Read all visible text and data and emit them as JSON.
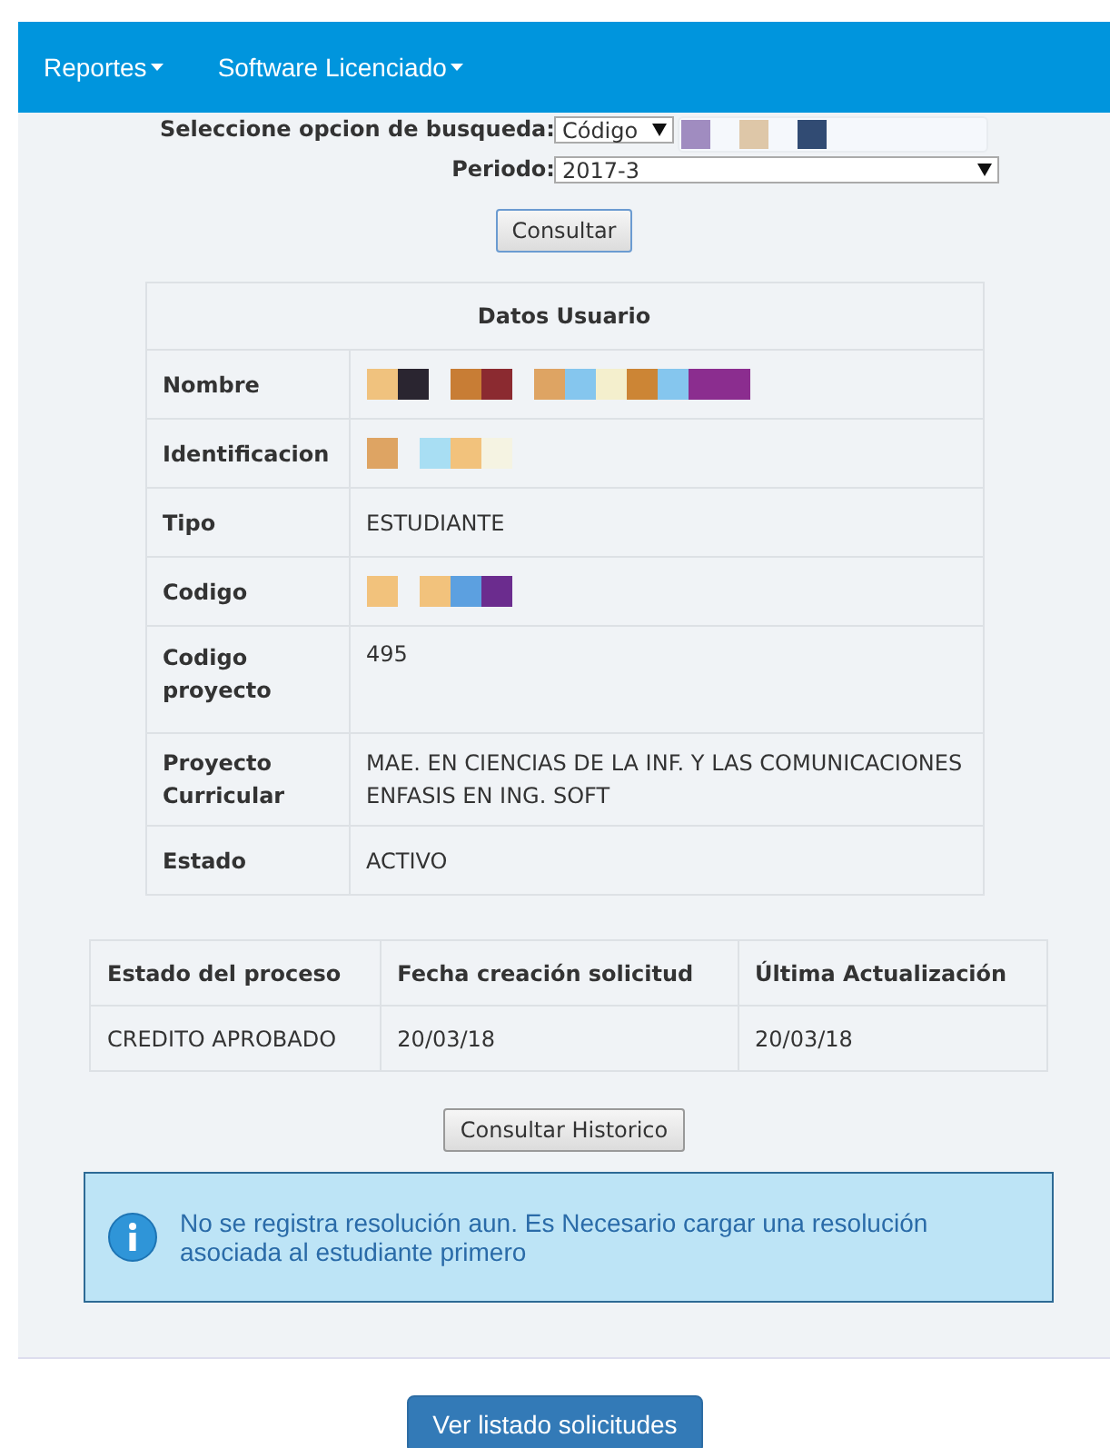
{
  "navbar": {
    "menus": [
      {
        "label": "Reportes"
      },
      {
        "label": "Software Licenciado"
      }
    ]
  },
  "search": {
    "label": "Seleccione opcion de busqueda",
    "colon": ":",
    "option": "Código",
    "value_redacted": [
      [
        {
          "color": "#a08cc0"
        }
      ],
      [
        {
          "color": "#dec7a8"
        }
      ],
      [
        {
          "color": "#314b73"
        }
      ]
    ]
  },
  "period": {
    "label": "Periodo",
    "colon": ":",
    "value": "2017-3"
  },
  "consult_button": "Consultar",
  "user_table": {
    "title": "Datos Usuario",
    "rows": [
      {
        "label": "Nombre",
        "redacted": [
          [
            {
              "color": "#f0c27e"
            },
            {
              "color": "#2a2530"
            }
          ],
          [
            {
              "color": "#c87d35"
            },
            {
              "color": "#8b2a30"
            }
          ],
          [
            {
              "color": "#dea463"
            },
            {
              "color": "#85c6ee"
            },
            {
              "color": "#f4efcd"
            },
            {
              "color": "#cc8535"
            },
            {
              "color": "#85c6ee"
            },
            {
              "color": "#8b2d8f"
            },
            {
              "color": "#8b2d8f"
            }
          ]
        ]
      },
      {
        "label": "Identificacion",
        "redacted": [
          [
            {
              "color": "#dea463"
            }
          ],
          [
            {
              "color": "#a8def3"
            },
            {
              "color": "#f2c27c"
            },
            {
              "color": "#f5f3e2"
            }
          ]
        ]
      },
      {
        "label": "Tipo",
        "value": "ESTUDIANTE"
      },
      {
        "label": "Codigo",
        "redacted": [
          [
            {
              "color": "#f2c27c"
            }
          ],
          [
            {
              "color": "#f2c27c"
            },
            {
              "color": "#5ca0e0"
            },
            {
              "color": "#6b2c8e"
            }
          ]
        ]
      },
      {
        "label": "Codigo proyecto",
        "value": "495"
      },
      {
        "label": "Proyecto Curricular",
        "value": "MAE. EN CIENCIAS DE LA INF. Y LAS COMUNICACIONES ENFASIS EN ING. SOFT"
      },
      {
        "label": "Estado",
        "value": "ACTIVO"
      }
    ]
  },
  "process_table": {
    "columns": [
      "Estado del proceso",
      "Fecha creación solicitud",
      "Última Actualización"
    ],
    "rows": [
      [
        "CREDITO APROBADO",
        "20/03/18",
        "20/03/18"
      ]
    ]
  },
  "history_button": "Consultar Historico",
  "alert": {
    "kind": "info",
    "text": "No se registra resolución aun. Es Necesario cargar una resolución asociada al estudiante primero"
  },
  "list_button": "Ver listado solicitudes"
}
